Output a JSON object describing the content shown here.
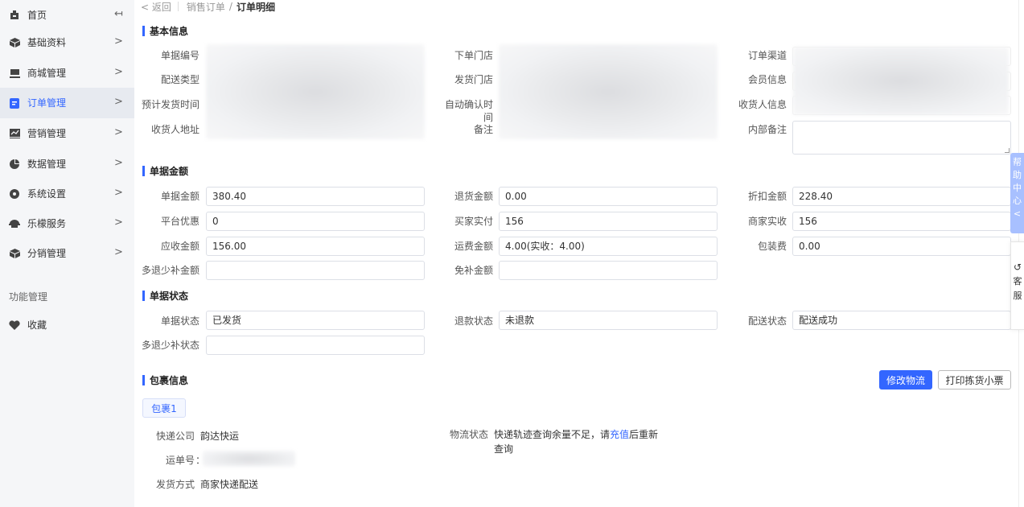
{
  "sidebar": {
    "items": [
      {
        "label": "首页",
        "icon": "home-icon",
        "arrow": "↤"
      },
      {
        "label": "基础资料",
        "icon": "cube-icon",
        "arrow": ">"
      },
      {
        "label": "商城管理",
        "icon": "store-icon",
        "arrow": ">"
      },
      {
        "label": "订单管理",
        "icon": "order-icon",
        "arrow": ">"
      },
      {
        "label": "营销管理",
        "icon": "chart-icon",
        "arrow": ">"
      },
      {
        "label": "数据管理",
        "icon": "pie-icon",
        "arrow": ">"
      },
      {
        "label": "系统设置",
        "icon": "gear-icon",
        "arrow": ">"
      },
      {
        "label": "乐檬服务",
        "icon": "service-icon",
        "arrow": ">"
      },
      {
        "label": "分销管理",
        "icon": "cube-icon",
        "arrow": ">"
      }
    ],
    "group_title": "功能管理",
    "favorites": "收藏",
    "active_color": "#3366ff"
  },
  "breadcrumb": {
    "back": "< 返回",
    "parent": "销售订单",
    "separator": "/",
    "current": "订单明细"
  },
  "basic": {
    "title": "基本信息",
    "bill_no": "单据编号",
    "store": "下单门店",
    "channel": "订单渠道",
    "delivery_type": "配送类型",
    "ship_store": "发货门店",
    "member": "会员信息",
    "est_ship_time": "预计发货时间",
    "auto_confirm_time": "自动确认时间",
    "receiver": "收货人信息",
    "address": "收货人地址",
    "remark": "备注",
    "internal_remark": "内部备注"
  },
  "amount": {
    "title": "单据金额",
    "bill_amount_label": "单据金额",
    "bill_amount": "380.40",
    "refund_amount_label": "退货金额",
    "refund_amount": "0.00",
    "discount_label": "折扣金额",
    "discount": "228.40",
    "platform_label": "平台优惠",
    "platform": "0",
    "buyer_paid_label": "买家实付",
    "buyer_paid": "156",
    "merchant_recv_label": "商家实收",
    "merchant_recv": "156",
    "receivable_label": "应收金额",
    "receivable": "156.00",
    "freight_label": "运费金额",
    "freight": "4.00(实收：4.00)",
    "packing_label": "包装费",
    "packing": "0.00",
    "over_under_label": "多退少补金额",
    "over_under": "",
    "free_label": "免补金额",
    "free": ""
  },
  "status": {
    "title": "单据状态",
    "bill_status_label": "单据状态",
    "bill_status": "已发货",
    "refund_status_label": "退款状态",
    "refund_status": "未退款",
    "delivery_status_label": "配送状态",
    "delivery_status": "配送成功",
    "over_under_status_label": "多退少补状态",
    "over_under_status": ""
  },
  "package": {
    "title": "包裹信息",
    "modify_btn": "修改物流",
    "print_btn": "打印拣货小票",
    "tab": "包裹1",
    "courier_label": "快递公司",
    "courier": "韵达快运",
    "tracking_label": "运单号",
    "tracking_colon": "：",
    "ship_method_label": "发货方式",
    "ship_method": "商家快递配送",
    "logistics_label": "物流状态",
    "logistics_pre": "快递轨迹查询余量不足，请",
    "logistics_link": "充值",
    "logistics_post": "后重新",
    "logistics_line2": "查询"
  },
  "right": {
    "help": [
      "帮",
      "助",
      "中",
      "心",
      "<"
    ],
    "service_icon": "refresh-icon",
    "service": [
      "客",
      "服"
    ]
  }
}
